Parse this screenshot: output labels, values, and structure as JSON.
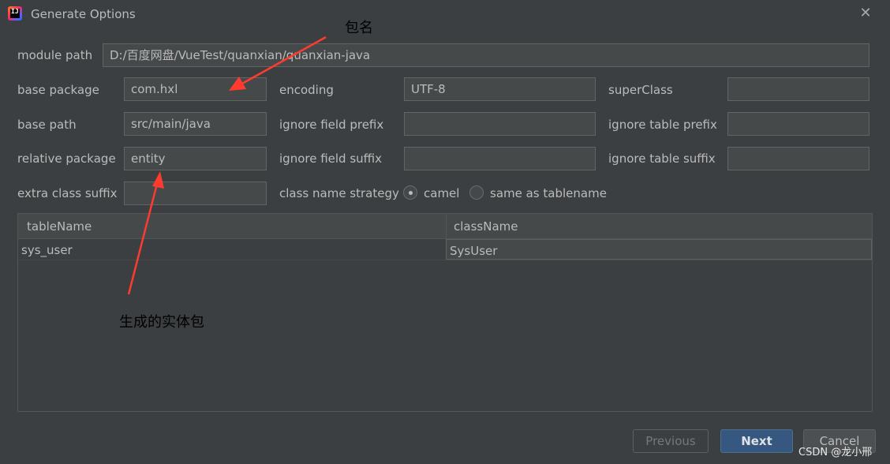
{
  "window": {
    "title": "Generate Options",
    "app_icon_text": "IJ"
  },
  "form": {
    "module_path": {
      "label": "module path",
      "value": "D:/百度网盘/VueTest/quanxian/quanxian-java"
    },
    "base_package": {
      "label": "base package",
      "value": "com.hxl"
    },
    "base_path": {
      "label": "base path",
      "value": "src/main/java"
    },
    "relative_package": {
      "label": "relative package",
      "value": "entity"
    },
    "extra_class_suffix": {
      "label": "extra class suffix",
      "value": ""
    },
    "encoding": {
      "label": "encoding",
      "value": "UTF-8"
    },
    "ignore_field_prefix": {
      "label": "ignore field prefix",
      "value": ""
    },
    "ignore_field_suffix": {
      "label": "ignore field suffix",
      "value": ""
    },
    "super_class": {
      "label": "superClass",
      "value": ""
    },
    "ignore_table_prefix": {
      "label": "ignore table prefix",
      "value": ""
    },
    "ignore_table_suffix": {
      "label": "ignore table suffix",
      "value": ""
    },
    "class_name_strategy": {
      "label": "class name strategy",
      "options": [
        {
          "label": "camel",
          "selected": true
        },
        {
          "label": "same as tablename",
          "selected": false
        }
      ]
    }
  },
  "table": {
    "columns": [
      "tableName",
      "className"
    ],
    "rows": [
      [
        "sys_user",
        "SysUser"
      ]
    ]
  },
  "buttons": {
    "previous": "Previous",
    "next": "Next",
    "cancel": "Cancel"
  },
  "annotations": {
    "package_name": "包名",
    "entity_package": "生成的实体包",
    "arrow_color": "#ff3b30"
  },
  "watermark": "CSDN @龙小邢",
  "colors": {
    "background": "#3c3f41",
    "field": "#45494a",
    "accent_button": "#365880"
  }
}
